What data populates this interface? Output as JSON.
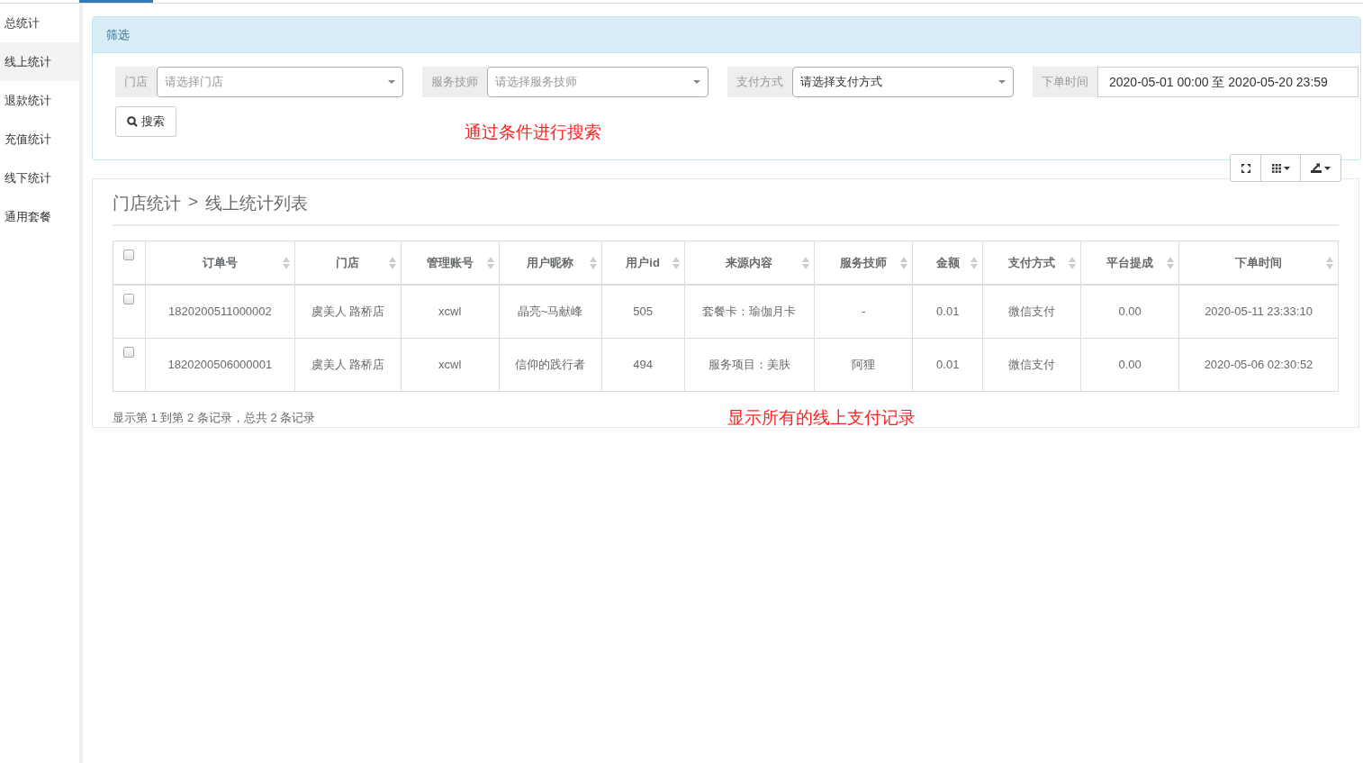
{
  "sidebar": {
    "items": [
      {
        "label": "总统计",
        "selected": false
      },
      {
        "label": "线上统计",
        "selected": true
      },
      {
        "label": "退款统计",
        "selected": false
      },
      {
        "label": "充值统计",
        "selected": false
      },
      {
        "label": "线下统计",
        "selected": false
      },
      {
        "label": "通用套餐",
        "selected": false
      }
    ]
  },
  "filter_panel": {
    "title": "筛选",
    "fields": [
      {
        "kind": "select",
        "label": "门店",
        "placeholder": "请选择门店"
      },
      {
        "kind": "select",
        "label": "服务技师",
        "placeholder": "请选择服务技师"
      },
      {
        "kind": "select",
        "label": "支付方式",
        "value": "请选择支付方式"
      },
      {
        "kind": "text",
        "label": "下单时间",
        "value": "2020-05-01 00:00 至 2020-05-20 23:59"
      }
    ],
    "search_button": "搜索",
    "annotation": "通过条件进行搜索"
  },
  "table_panel": {
    "breadcrumb": [
      "门店统计",
      ">",
      "线上统计列表"
    ],
    "table": {
      "header_checked": false,
      "columns": [
        "订单号",
        "门店",
        "管理账号",
        "用户昵称",
        "用户id",
        "来源内容",
        "服务技师",
        "金额",
        "支付方式",
        "平台提成",
        "下单时间"
      ],
      "rows": [
        {
          "selected": false,
          "cells": [
            "1820200511000002",
            "虞美人 路桥店",
            "xcwl",
            "晶亮~马献峰",
            "505",
            "套餐卡：瑜伽月卡",
            "-",
            "0.01",
            "微信支付",
            "0.00",
            "2020-05-11 23:33:10"
          ]
        },
        {
          "selected": false,
          "cells": [
            "1820200506000001",
            "虞美人 路桥店",
            "xcwl",
            "信仰的践行者",
            "494",
            "服务项目：美肤",
            "阿狸",
            "0.01",
            "微信支付",
            "0.00",
            "2020-05-06 02:30:52"
          ]
        }
      ]
    },
    "summary": "显示第 1 到第 2 条记录，总共 2 条记录",
    "annotation": "显示所有的线上支付记录"
  }
}
